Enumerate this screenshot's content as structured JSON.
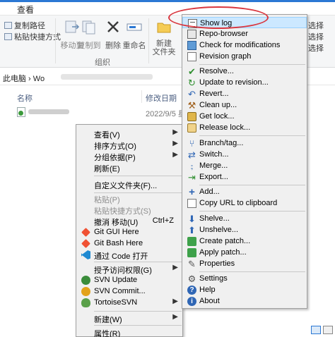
{
  "window": {
    "title": "查看"
  },
  "ribbon": {
    "copy_path": "复制路径",
    "paste_shortcut": "粘贴快捷方式",
    "move_to": "移动到",
    "copy_to": "复制到",
    "delete": "删除",
    "rename": "重命名",
    "new_folder": "新建\n文件夹",
    "group_organize": "组织",
    "right_select_1": "选择",
    "right_select_2": "选择",
    "right_select_3": "选择"
  },
  "address": {
    "path": "此电脑 › Wo"
  },
  "columns": {
    "name": "名称",
    "modified": "修改日期"
  },
  "file": {
    "date": "2022/9/5 星期"
  },
  "context_menu": {
    "items": [
      {
        "label": "查看(V)",
        "submenu": true
      },
      {
        "label": "排序方式(O)",
        "submenu": true
      },
      {
        "label": "分组依据(P)",
        "submenu": true
      },
      {
        "label": "刷新(E)"
      },
      {
        "label": "自定义文件夹(F)..."
      },
      {
        "label": "粘贴(P)",
        "disabled": true
      },
      {
        "label": "粘贴快捷方式(S)",
        "disabled": true
      },
      {
        "label": "撤消 移动(U)",
        "accel": "Ctrl+Z"
      },
      {
        "label": "Git GUI Here",
        "icon": "git-icon"
      },
      {
        "label": "Git Bash Here",
        "icon": "git-icon"
      },
      {
        "label": "通过 Code 打开",
        "icon": "vscode-icon"
      },
      {
        "label": "授予访问权限(G)",
        "submenu": true
      },
      {
        "label": "SVN Update",
        "icon": "svn-update-icon"
      },
      {
        "label": "SVN Commit...",
        "icon": "svn-commit-icon"
      },
      {
        "label": "TortoiseSVN",
        "icon": "tortoise-icon",
        "submenu": true
      },
      {
        "label": "新建(W)",
        "submenu": true
      },
      {
        "label": "属性(R)"
      }
    ]
  },
  "svn_menu": {
    "items": [
      {
        "label": "Show log",
        "icon": "log-icon"
      },
      {
        "label": "Repo-browser",
        "icon": "repo-browser-icon"
      },
      {
        "label": "Check for modifications",
        "icon": "check-modifications-icon"
      },
      {
        "label": "Revision graph",
        "icon": "revision-graph-icon"
      },
      {
        "label": "Resolve...",
        "icon": "resolve-icon"
      },
      {
        "label": "Update to revision...",
        "icon": "update-revision-icon"
      },
      {
        "label": "Revert...",
        "icon": "revert-icon"
      },
      {
        "label": "Clean up...",
        "icon": "cleanup-icon"
      },
      {
        "label": "Get lock...",
        "icon": "lock-icon"
      },
      {
        "label": "Release lock...",
        "icon": "unlock-icon"
      },
      {
        "label": "Branch/tag...",
        "icon": "branch-icon"
      },
      {
        "label": "Switch...",
        "icon": "switch-icon"
      },
      {
        "label": "Merge...",
        "icon": "merge-icon"
      },
      {
        "label": "Export...",
        "icon": "export-icon"
      },
      {
        "label": "Add...",
        "icon": "add-icon"
      },
      {
        "label": "Copy URL to clipboard",
        "icon": "copy-url-icon"
      },
      {
        "label": "Shelve...",
        "icon": "shelve-icon"
      },
      {
        "label": "Unshelve...",
        "icon": "unshelve-icon"
      },
      {
        "label": "Create patch...",
        "icon": "create-patch-icon"
      },
      {
        "label": "Apply patch...",
        "icon": "apply-patch-icon"
      },
      {
        "label": "Properties",
        "icon": "properties-icon"
      },
      {
        "label": "Settings",
        "icon": "settings-icon"
      },
      {
        "label": "Help",
        "icon": "help-icon"
      },
      {
        "label": "About",
        "icon": "about-icon"
      }
    ]
  },
  "colors": {
    "annotation": "#d9363e",
    "highlight": "#cce8ff",
    "accent": "#2b78d4"
  }
}
